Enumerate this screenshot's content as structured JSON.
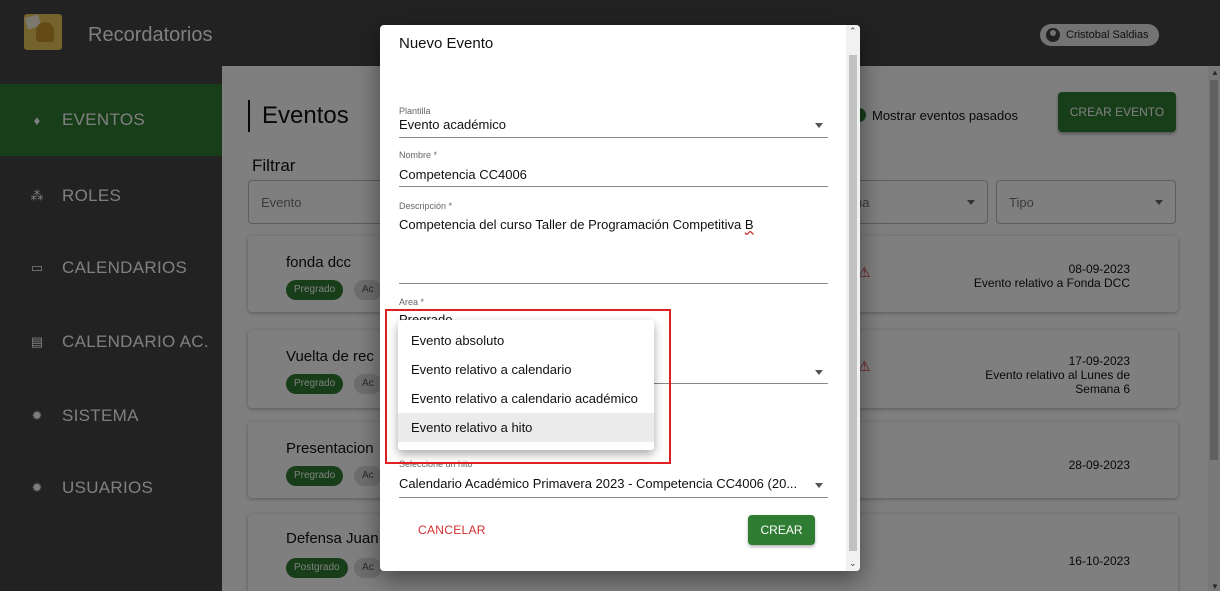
{
  "app": {
    "title": "Recordatorios",
    "user": "Cristobal Saldias"
  },
  "sidebar": {
    "items": [
      {
        "label": "EVENTOS",
        "icon": "trophy-icon",
        "glyph": "♦"
      },
      {
        "label": "ROLES",
        "icon": "people-icon",
        "glyph": "⁂"
      },
      {
        "label": "CALENDARIOS",
        "icon": "calendar-icon",
        "glyph": "▭"
      },
      {
        "label": "CALENDARIO AC.",
        "icon": "book-icon",
        "glyph": "▤"
      },
      {
        "label": "SISTEMA",
        "icon": "gear-icon",
        "glyph": "✹"
      },
      {
        "label": "USUARIOS",
        "icon": "gear-icon",
        "glyph": "✹"
      }
    ]
  },
  "main": {
    "title": "Eventos",
    "filter_title": "Filtrar",
    "filter_event_placeholder": "Evento",
    "filter_partial": "na",
    "filter_type_placeholder": "Tipo",
    "show_past_label": "Mostrar eventos pasados",
    "create_event_label": "CREAR EVENTO",
    "cards": [
      {
        "title": "fonda dcc",
        "chips": [
          "Pregrado",
          "Ac"
        ],
        "date": "08-09-2023",
        "relative": "Evento relativo a Fonda DCC",
        "relative2": "",
        "warning": true
      },
      {
        "title": "Vuelta de rec",
        "chips": [
          "Pregrado",
          "Ac"
        ],
        "date": "17-09-2023",
        "relative": "Evento relativo al Lunes de",
        "relative2": "Semana 6",
        "warning": true
      },
      {
        "title": "Presentacion",
        "chips": [
          "Pregrado",
          "Ac"
        ],
        "date": "28-09-2023",
        "relative": "",
        "relative2": "",
        "warning": false
      },
      {
        "title": "Defensa Juan",
        "chips": [
          "Postgrado",
          "Ac"
        ],
        "date": "16-10-2023",
        "relative": "",
        "relative2": "",
        "warning": false
      }
    ]
  },
  "dialog": {
    "title": "Nuevo Evento",
    "plantilla_label": "Plantilla",
    "plantilla_value": "Evento académico",
    "nombre_label": "Nombre *",
    "nombre_value": "Competencia CC4006",
    "descripcion_label": "Descripción *",
    "descripcion_value_main": "Competencia del curso Taller de Programación Competitiva ",
    "descripcion_value_tail": "B",
    "area_label": "Area *",
    "area_value": "Pregrado",
    "hito_label": "Seleccione un hito",
    "hito_value": "Calendario Académico Primavera 2023 - Competencia CC4006 (20...",
    "cancel_label": "CANCELAR",
    "create_label": "CREAR"
  },
  "menu": {
    "options": [
      "Evento absoluto",
      "Evento relativo a calendario",
      "Evento relativo a calendario académico",
      "Evento relativo a hito"
    ],
    "highlighted": "Evento relativo a hito"
  },
  "colors": {
    "accent": "#2e7d32",
    "sidebar": "#444444",
    "danger": "#d32f2f",
    "highlight_box": "#e02020"
  }
}
